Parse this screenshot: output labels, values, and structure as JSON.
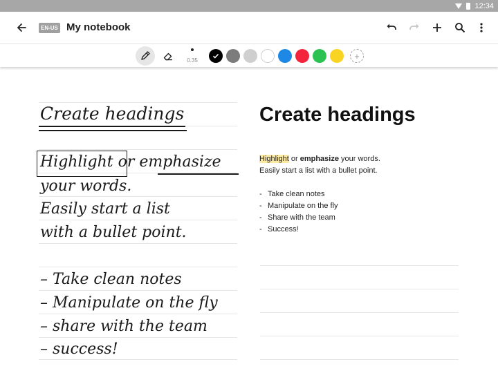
{
  "status_bar": {
    "time": "12:34"
  },
  "app_bar": {
    "language": "EN-US",
    "title": "My notebook",
    "icons": [
      "arrow-back-icon",
      "undo-icon",
      "redo-icon",
      "add-icon",
      "search-icon",
      "more-vert-icon"
    ]
  },
  "toolbar": {
    "tools": [
      "pen-icon",
      "eraser-icon"
    ],
    "active_tool": "pen",
    "pen_size": "0.35",
    "colors": [
      "#000000",
      "#7c7c7c",
      "#cfcfcf",
      "#ffffff",
      "#1e88e5",
      "#f4243c",
      "#2bc251",
      "#f9d423"
    ],
    "selected_color": "#000000",
    "add_color_symbol": "+"
  },
  "handwriting": {
    "heading": "Create headings",
    "line1_boxed": "Highlight",
    "line1_mid": " or ",
    "line1_underlined": "emphasize",
    "line2": "your words.",
    "line3": "Easily start a list",
    "line4": "with a bullet point.",
    "items": [
      "– Take clean notes",
      "– Manipulate on the fly",
      "– share with the team",
      "– success!"
    ]
  },
  "converted": {
    "heading": "Create headings",
    "highlight_word": "Highlight",
    "or_word": " or ",
    "emphasize_word": "emphasize",
    "rest_line1": " your words.",
    "line2": "Easily start a list with a bullet point.",
    "items": [
      "Take clean notes",
      "Manipulate on the fly",
      "Share with the team",
      "Success!"
    ],
    "bullet": "-",
    "highlight_color": "#fde9a0"
  }
}
